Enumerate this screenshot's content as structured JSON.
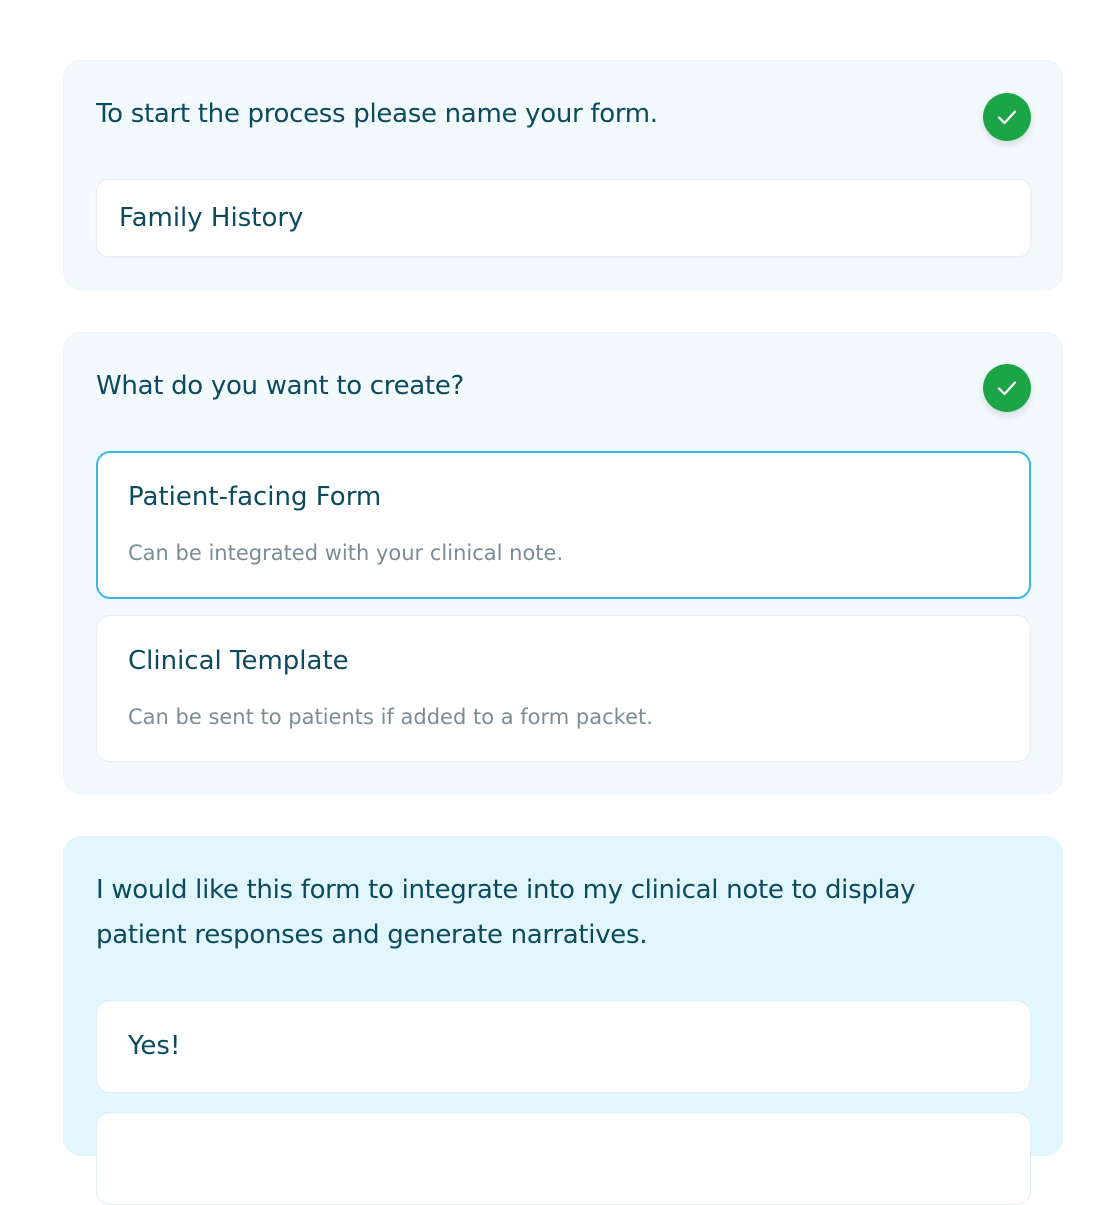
{
  "step_name": {
    "question": "To start the process please name your form.",
    "completed": true,
    "value": "Family History",
    "check_icon": "check-icon"
  },
  "step_type": {
    "question": "What do you want to create?",
    "completed": true,
    "check_icon": "check-icon",
    "options": [
      {
        "title": "Patient-facing Form",
        "description": "Can be integrated with your clinical note.",
        "selected": true
      },
      {
        "title": "Clinical Template",
        "description": "Can be sent to patients if added to a form packet.",
        "selected": false
      }
    ]
  },
  "step_integrate": {
    "question_line1": "I would like this form to integrate into my clinical note to display",
    "question_line2": "patient responses and generate narratives.",
    "answers": [
      {
        "label": "Yes!"
      }
    ]
  },
  "colors": {
    "check_green": "#1ba547",
    "heading_teal": "#0c4a5e",
    "selected_border": "#36b7e8",
    "active_card_bg": "#e2f6fd"
  }
}
